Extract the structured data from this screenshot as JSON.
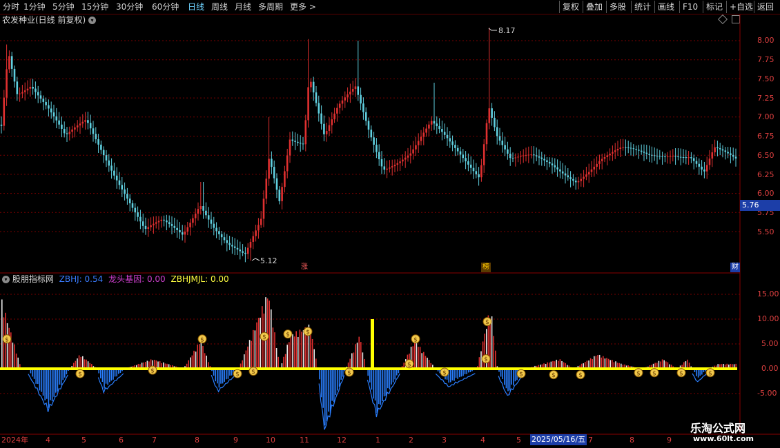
{
  "toolbar": {
    "periods": [
      "分时",
      "1分钟",
      "5分钟",
      "15分钟",
      "30分钟",
      "60分钟",
      "日线",
      "周线",
      "月线",
      "多周期",
      "更多 >"
    ],
    "active": "日线",
    "right": [
      "复权",
      "叠加",
      "多股",
      "统计",
      "画线",
      "F10",
      "标记",
      "+自选",
      "返回"
    ]
  },
  "chart_title": "农发种业(日线 前复权)",
  "price_axis": [
    "8.00",
    "7.75",
    "7.50",
    "7.25",
    "7.00",
    "6.75",
    "6.50",
    "6.25",
    "6.00",
    "5.75",
    "5.50"
  ],
  "current_price": "5.76",
  "high_label": "8.17",
  "low_label": "5.12",
  "badges": {
    "zhang": "涨",
    "bang": "榜",
    "cai": "财"
  },
  "indicator": {
    "name": "股朋指标网",
    "zbhj_label": "ZBHJ: 0.54",
    "ltjy_label": "龙头基因: 0.00",
    "zbhjmjl_label": "ZBHJMJL: 0.00",
    "axis": [
      "15.00",
      "10.00",
      "5.00",
      "0.00",
      "-5.00"
    ]
  },
  "date_axis": [
    "2024年",
    "4",
    "5",
    "6",
    "7",
    "8",
    "9",
    "10",
    "11",
    "12",
    "1",
    "2",
    "3",
    "4",
    "5",
    "7",
    "8",
    "9"
  ],
  "date_highlight": "2025/05/16/五",
  "watermark": {
    "line1": "乐淘公式网",
    "line2": "www.60lt.com"
  },
  "colors": {
    "up": "#e03030",
    "down": "#60d0e0",
    "bg": "#000000",
    "grid": "#7a0000",
    "yellow": "#ffff00",
    "blue": "#2a7fff"
  },
  "chart_data": {
    "type": "candlestick",
    "price_range": [
      5.12,
      8.17
    ],
    "indicator_range": [
      -5,
      15
    ]
  }
}
